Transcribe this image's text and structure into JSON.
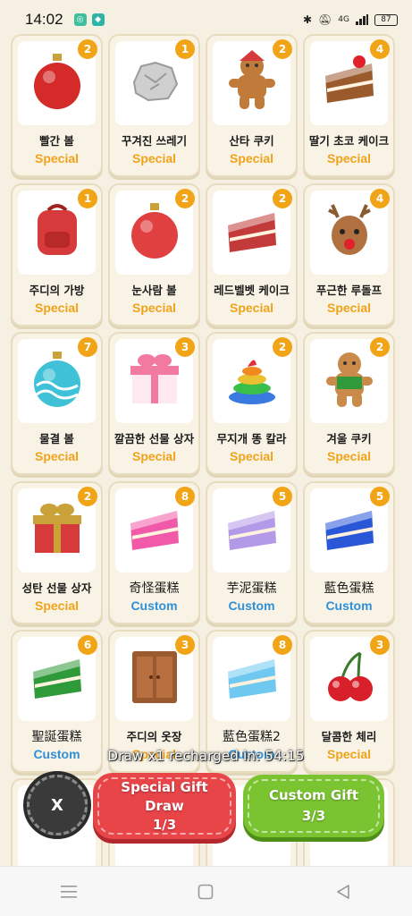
{
  "status_bar": {
    "time": "14:02",
    "network": "4G",
    "battery": "87"
  },
  "items": [
    {
      "name": "빨간 볼",
      "type": "Special",
      "count": "2",
      "icon": "red-ornament-icon",
      "color": "#d42a2a"
    },
    {
      "name": "꾸겨진 쓰레기",
      "type": "Special",
      "count": "1",
      "icon": "crumpled-paper-icon",
      "color": "#cfcfcf"
    },
    {
      "name": "산타 쿠키",
      "type": "Special",
      "count": "2",
      "icon": "santa-cookie-icon",
      "color": "#c07a3a"
    },
    {
      "name": "딸기 초코 케이크",
      "type": "Special",
      "count": "4",
      "icon": "strawberry-cake-icon",
      "color": "#9a5a2c"
    },
    {
      "name": "주디의 가방",
      "type": "Special",
      "count": "1",
      "icon": "red-backpack-icon",
      "color": "#d63a3a"
    },
    {
      "name": "눈사람 볼",
      "type": "Special",
      "count": "2",
      "icon": "snowman-ornament-icon",
      "color": "#e04040"
    },
    {
      "name": "레드벨벳 케이크",
      "type": "Special",
      "count": "2",
      "icon": "red-velvet-cake-icon",
      "color": "#c23a3a"
    },
    {
      "name": "푸근한 루돌프",
      "type": "Special",
      "count": "4",
      "icon": "reindeer-icon",
      "color": "#b07040"
    },
    {
      "name": "물결 볼",
      "type": "Special",
      "count": "7",
      "icon": "wave-ornament-icon",
      "color": "#3fc2d8"
    },
    {
      "name": "깔끔한 선물 상자",
      "type": "Special",
      "count": "3",
      "icon": "gift-box-icon",
      "color": "#f27aa0"
    },
    {
      "name": "무지개 똥 칼라",
      "type": "Special",
      "count": "2",
      "icon": "rainbow-poop-icon",
      "color": "#e8c030"
    },
    {
      "name": "겨울 쿠키",
      "type": "Special",
      "count": "2",
      "icon": "gingerbread-icon",
      "color": "#c98a4a"
    },
    {
      "name": "성탄 선물 상자",
      "type": "Special",
      "count": "2",
      "icon": "christmas-gift-icon",
      "color": "#d63a3a"
    },
    {
      "name": "奇怪蛋糕",
      "type": "Custom",
      "count": "8",
      "icon": "pink-cake-icon",
      "color": "#f05aa8"
    },
    {
      "name": "芋泥蛋糕",
      "type": "Custom",
      "count": "5",
      "icon": "taro-cake-icon",
      "color": "#b39ae8"
    },
    {
      "name": "藍色蛋糕",
      "type": "Custom",
      "count": "5",
      "icon": "blue-cake-icon",
      "color": "#2a56d8"
    },
    {
      "name": "聖誕蛋糕",
      "type": "Custom",
      "count": "6",
      "icon": "christmas-cake-icon",
      "color": "#2f9a3a"
    },
    {
      "name": "주디의 옷장",
      "type": "Special",
      "count": "3",
      "icon": "wardrobe-icon",
      "color": "#9a5a30"
    },
    {
      "name": "藍色蛋糕2",
      "type": "Custom",
      "count": "8",
      "icon": "light-blue-cake-icon",
      "color": "#6ec8f0"
    },
    {
      "name": "달콤한 체리",
      "type": "Special",
      "count": "3",
      "icon": "cherry-icon",
      "color": "#d8202a"
    }
  ],
  "recharge_text": "Draw x1 recharged in: 54:15",
  "buttons": {
    "close": "X",
    "special_line1": "Special Gift",
    "special_line2": "Draw",
    "special_line3": "1/3",
    "custom_line1": "Custom Gift",
    "custom_line2": "3/3"
  }
}
